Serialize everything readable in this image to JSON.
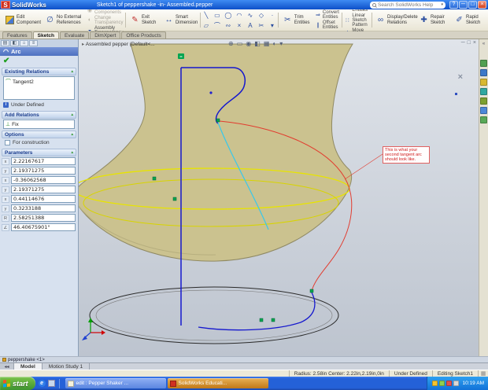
{
  "colors": {
    "titlebar-top": "#3F8CF3",
    "titlebar-bottom": "#0D50C8",
    "xp-face": "#ECE9D8",
    "panel-bg": "#D7E1EF",
    "panel-title-a": "#7694D8",
    "panel-title-b": "#4E71C0",
    "viewport-top": "#E0E4EA",
    "viewport-bottom": "#BDC4CF",
    "bell-fill": "#CBC28F",
    "bell-edge": "#8F8963",
    "silhouette-yellow": "#E8E400",
    "sketch-blue": "#1518CE",
    "spline-red": "#E23B2E",
    "aux-cyan": "#38C8EC",
    "marker-green": "#00A550",
    "taskbar-blue": "#2461D8",
    "task-btn-a": "#4E86F2",
    "task-btn-b": "#2E62D8",
    "flash-a": "#E8B054",
    "flash-b": "#C07818",
    "start-a": "#7CC34A",
    "start-b": "#3D9430",
    "tray-a": "#2FA0F0",
    "tray-b": "#1272D8",
    "flag-red": "#F35325",
    "flag-green": "#81BC06",
    "flag-blue": "#05A6F0",
    "flag-yellow": "#FFBA08"
  },
  "icons": {
    "minimize": "─",
    "maximize": "□",
    "close": "×",
    "help": "?",
    "search_dropdown": "▾",
    "doc_min": "─",
    "doc_restore": "□",
    "doc_close": "×",
    "section_chevron": "▴",
    "confirm_check": "✔",
    "arc": "◠",
    "tangent_relation": "⌒",
    "info": "i",
    "fix_relation": "⊥",
    "no_external_references": "∅",
    "hide_show": "◉",
    "change_transparency": "◐",
    "assembly_transparency": "◒",
    "exit_sketch": "✎",
    "smart_dimension": "↔",
    "trim": "✂",
    "convert": "⇒",
    "offset": "∥",
    "mirror": "⋈",
    "linear_pattern": "∷",
    "move": "+",
    "display_delete": "∞",
    "repair": "✚",
    "rapid": "✐",
    "confirm_corner_x": "×",
    "tab_nav": "◂◂",
    "ie": "e",
    "grid_corner": "▦",
    "breadcrumb_arrow": "▸"
  },
  "titlebar": {
    "brand": "SolidWorks",
    "title": "Sketch1 of peppershake -in- Assembled.pepper",
    "search_placeholder": "Search SolidWorks Help"
  },
  "toolbar": {
    "edit_component": "Edit Component",
    "no_external_references": "No External References",
    "hide_show_components": "Hide/Show Components",
    "change_transparency": "Change Transparency",
    "assembly_transparency": "Assembly Transparency",
    "exit_sketch": "Exit Sketch",
    "smart_dimension": "Smart Dimension",
    "sketch_tools_row1": [
      "╲",
      "▭",
      "◯",
      "◠",
      "∿",
      "◇",
      "·"
    ],
    "sketch_tools_row2": [
      "▱",
      "⌒",
      "∾",
      "×",
      "A",
      "✂",
      "▾"
    ],
    "trim_entities": "Trim Entities",
    "convert_entities": "Convert Entities",
    "offset_entities": "Offset Entities",
    "mirror_entities": "Mirror Entities",
    "linear_sketch_pattern": "Linear Sketch Pattern",
    "move_entities": "Move Entities",
    "display_delete_relations": "Display/Delete Relations",
    "repair_sketch": "Repair Sketch",
    "rapid_sketch": "Rapid Sketch"
  },
  "command_tabs": [
    {
      "label": "Features",
      "active": false
    },
    {
      "label": "Sketch",
      "active": true
    },
    {
      "label": "Evaluate",
      "active": false
    },
    {
      "label": "DimXpert",
      "active": false
    },
    {
      "label": "Office Products",
      "active": false
    }
  ],
  "panel": {
    "tabs": [
      "▤",
      "◧",
      "⌂",
      "≡"
    ],
    "title": "Arc",
    "existing_relations": {
      "header": "Existing Relations",
      "items": [
        {
          "label": "Tangent2"
        }
      ],
      "status": "Under Defined"
    },
    "add_relations": {
      "header": "Add Relations",
      "items": [
        {
          "label": "Fix"
        }
      ]
    },
    "options": {
      "header": "Options",
      "for_construction_label": "For construction",
      "checked": false
    },
    "parameters": {
      "header": "Parameters",
      "fields": [
        {
          "name": "center-x",
          "icon": "x",
          "value": "2.22167617"
        },
        {
          "name": "center-y",
          "icon": "y",
          "value": "2.19371275"
        },
        {
          "name": "start-x",
          "icon": "x",
          "value": "-0.36062568"
        },
        {
          "name": "start-y",
          "icon": "y",
          "value": "2.19371275"
        },
        {
          "name": "end-x",
          "icon": "x",
          "value": "0.44114676"
        },
        {
          "name": "end-y",
          "icon": "y",
          "value": "0.3233188"
        },
        {
          "name": "radius",
          "icon": "R",
          "value": "2.58251388"
        },
        {
          "name": "angle",
          "icon": "∠",
          "value": "46.40675901°"
        }
      ]
    }
  },
  "viewport": {
    "breadcrumb": "Assembled pepper (Default<...",
    "headsup_glyphs": [
      "⊕",
      "▭",
      "◉",
      "◧",
      "▦",
      "◐",
      "▾"
    ],
    "annotation": "This is what your second tangent arc should look like."
  },
  "right_toolbar": {
    "icons": [
      {
        "name": "right-tool-1",
        "color": "#52A052"
      },
      {
        "name": "right-tool-2",
        "color": "#3C78C8"
      },
      {
        "name": "right-tool-3",
        "color": "#D8B830"
      },
      {
        "name": "right-tool-4",
        "color": "#30A8A0"
      },
      {
        "name": "right-tool-5",
        "color": "#7CA030"
      },
      {
        "name": "right-tool-6",
        "color": "#4C88D8"
      },
      {
        "name": "right-tool-7",
        "color": "#58A858"
      }
    ]
  },
  "bottom": {
    "tree_item": "peppershake <1>",
    "tabs": [
      {
        "label": "Model",
        "active": true
      },
      {
        "label": "Motion Study 1",
        "active": false
      }
    ]
  },
  "statusbar": {
    "measurement": "Radius: 2.58in  Center: 2.22in,2.19in,0in",
    "state": "Under Defined",
    "mode": "Editing Sketch1"
  },
  "taskbar": {
    "start_label": "start",
    "tasks": [
      {
        "label": "edit : Pepper Shaker ...",
        "icon_color": "#F6F2DC",
        "flashing": false
      },
      {
        "label": "SolidWorks Educati...",
        "icon_color": "#D03020",
        "flashing": true
      }
    ],
    "tray_icons": [
      {
        "name": "tray-1",
        "color": "#F4C430"
      },
      {
        "name": "tray-2",
        "color": "#8FD14F"
      },
      {
        "name": "tray-3",
        "color": "#E05050"
      },
      {
        "name": "tray-4",
        "color": "#D8D8D8"
      }
    ],
    "clock": "10:19 AM"
  }
}
